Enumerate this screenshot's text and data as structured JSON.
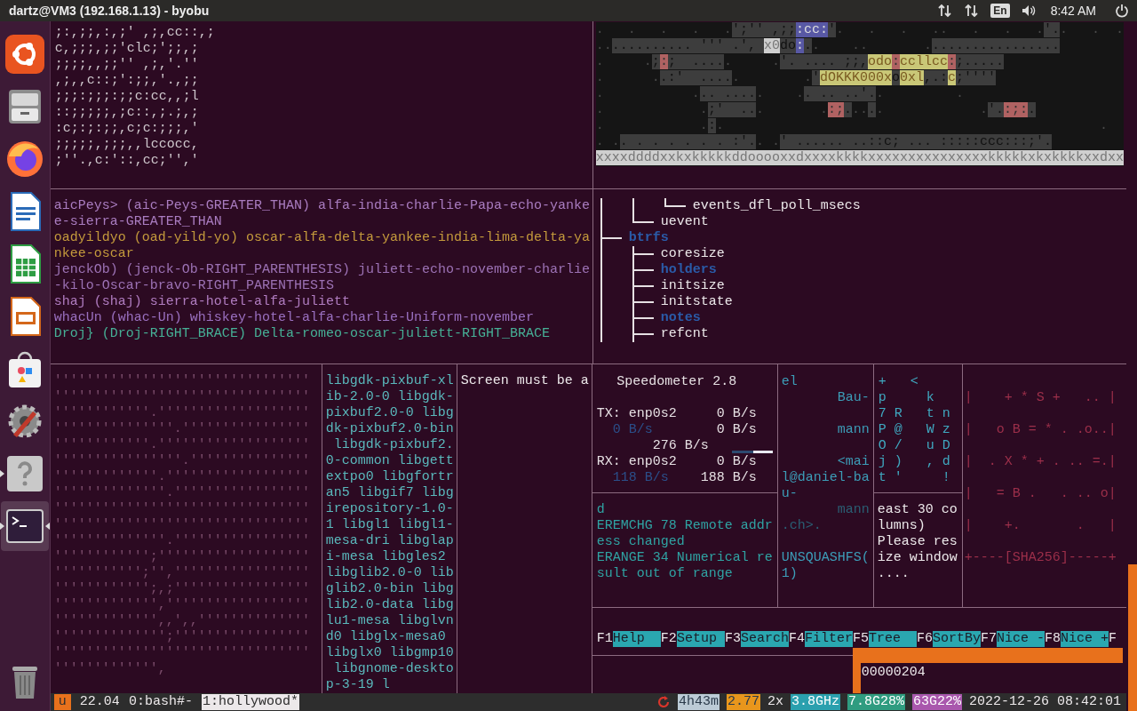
{
  "top_bar": {
    "title": "dartz@VM3 (192.168.1.13) - byobu",
    "language": "En",
    "clock": "8:42 AM"
  },
  "dock": {
    "items": [
      {
        "kind": "ubuntu",
        "running": false,
        "focused": false
      },
      {
        "kind": "files",
        "running": false,
        "focused": false
      },
      {
        "kind": "firefox",
        "running": false,
        "focused": false
      },
      {
        "kind": "writer",
        "running": false,
        "focused": false
      },
      {
        "kind": "calc",
        "running": false,
        "focused": false
      },
      {
        "kind": "impress",
        "running": false,
        "focused": false
      },
      {
        "kind": "software",
        "running": false,
        "focused": false
      },
      {
        "kind": "settings",
        "running": false,
        "focused": false
      },
      {
        "kind": "help",
        "running": true,
        "focused": false
      },
      {
        "kind": "terminal",
        "running": true,
        "focused": true
      },
      {
        "kind": "trash",
        "running": false,
        "focused": false
      }
    ]
  },
  "ascii_art": {
    "lines": [
      ";:,;;,:,;' ,;,cc::,;",
      "c,;;;,;;'clc;';;,;",
      ";;;;,,;;'' ,;,'.''",
      ",;,,c::;':;;,'.,;;",
      ";;;:;;;:;;c:cc,,;l",
      "::;;;;;,;c::,;.;,;",
      ":c;:;:;;,c;c:;;;,'",
      ";;;;;,;;;,,lccocc,",
      ";''.,c:'::,cc;'','"
    ]
  },
  "ascii_image": {
    "rows": [
      {
        "segments": [
          {
            "text": ".   .   .   .   .",
            "kind": "dark"
          },
          {
            "text": "';'' ,;;",
            "kind": "gray"
          },
          {
            "text": ":cc:",
            "kind": "blue"
          },
          {
            "text": "'",
            "kind": "gray"
          },
          {
            "text": ".   .   .   ..   .   .   .",
            "kind": "dark"
          },
          {
            "text": "'.",
            "kind": "gray"
          },
          {
            "text": ".   .  .",
            "kind": "dark"
          }
        ]
      },
      {
        "segments": [
          {
            "text": "..",
            "kind": "dark"
          },
          {
            "text": ".......... ''' .', ",
            "kind": "gray"
          },
          {
            "text": "x0",
            "kind": "light"
          },
          {
            "text": "do",
            "kind": "gray"
          },
          {
            "text": ":",
            "kind": "blue"
          },
          {
            "text": ".",
            "kind": "gray"
          },
          {
            "text": ".    ..       .",
            "kind": "dark"
          },
          {
            "text": "................",
            "kind": "gray"
          }
        ]
      },
      {
        "segments": [
          {
            "text": ".     .",
            "kind": "dark"
          },
          {
            "text": ";",
            "kind": "gray"
          },
          {
            "text": ":",
            "kind": "red"
          },
          {
            "text": ";  ....",
            "kind": "gray"
          },
          {
            "text": ".     .",
            "kind": "dark"
          },
          {
            "text": "'. .... ;;,",
            "kind": "gray"
          },
          {
            "text": "odo",
            "kind": "yellow"
          },
          {
            "text": ":",
            "kind": "red"
          },
          {
            "text": "ccllcc",
            "kind": "yellow"
          },
          {
            "text": ":",
            "kind": "red"
          },
          {
            "text": ";.....",
            "kind": "gray"
          }
        ]
      },
      {
        "segments": [
          {
            "text": ".      .",
            "kind": "dark"
          },
          {
            "text": ".:'  ....",
            "kind": "gray"
          },
          {
            "text": ".        .",
            "kind": "dark"
          },
          {
            "text": "'",
            "kind": "gray"
          },
          {
            "text": "dOKKK000x",
            "kind": "yellow"
          },
          {
            "text": "o",
            "kind": "gray"
          },
          {
            "text": "0xl",
            "kind": "yellow"
          },
          {
            "text": ",.:",
            "kind": "gray"
          },
          {
            "text": "c",
            "kind": "yellow"
          },
          {
            "text": ";''''",
            "kind": "gray"
          }
        ]
      },
      {
        "segments": [
          {
            "text": ".           .",
            "kind": "dark"
          },
          {
            "text": ".. ....",
            "kind": "gray"
          },
          {
            "text": ".    .",
            "kind": "dark"
          },
          {
            "text": ". .. ..'.",
            "kind": "gray"
          },
          {
            "text": ".         .",
            "kind": "dark"
          }
        ]
      },
      {
        "segments": [
          {
            "text": ".            .",
            "kind": "dark"
          },
          {
            "text": ";'  ..",
            "kind": "gray"
          },
          {
            "text": ".       .",
            "kind": "dark"
          },
          {
            "text": ":;",
            "kind": "red"
          },
          {
            "text": ".",
            "kind": "gray"
          },
          {
            "text": "..",
            "kind": "dark"
          },
          {
            "text": ".",
            "kind": "gray"
          },
          {
            "text": ".            .",
            "kind": "dark"
          },
          {
            "text": "'.",
            "kind": "gray"
          },
          {
            "text": ":;:",
            "kind": "red"
          },
          {
            "text": ".",
            "kind": "gray"
          }
        ]
      },
      {
        "segments": [
          {
            "text": ".            .",
            "kind": "dark"
          },
          {
            "text": ":",
            "kind": "gray"
          },
          {
            "text": ".                                               .",
            "kind": "dark"
          }
        ]
      },
      {
        "segments": [
          {
            "text": ". .",
            "kind": "dark"
          },
          {
            "text": ". . . . . . . :'.",
            "kind": "gray"
          },
          {
            "text": ". .",
            "kind": "dark"
          },
          {
            "text": "' ...... ..::c; ... :::::ccc:::;'.",
            "kind": "gray"
          }
        ]
      },
      {
        "segments": [
          {
            "text": "xxxxddddxxkxkkkkkddooooxxdxxxxkkkkxxxxxxxxxxxxxxxkkkkkxkxkkkkxxdxx",
            "kind": "light"
          }
        ]
      }
    ]
  },
  "word_list": {
    "entries": [
      {
        "color": "#a97cc0",
        "lines": [
          "aicPeys> (aic-Peys-GREATER_THAN) alfa-india-charlie-Papa-echo-yanke",
          "e-sierra-GREATER_THAN"
        ]
      },
      {
        "color": "#c49a3c",
        "lines": [
          "oadyildyo (oad-yild-yo) oscar-alfa-delta-yankee-india-lima-delta-ya",
          "nkee-oscar"
        ]
      },
      {
        "color": "#9c72b5",
        "lines": [
          "jenckOb) (jenck-Ob-RIGHT_PARENTHESIS) juliett-echo-november-charlie",
          "-kilo-Oscar-bravo-RIGHT_PARENTHESIS"
        ]
      },
      {
        "color": "#b07cc0",
        "lines": [
          "shaj (shaj) sierra-hotel-alfa-juliett"
        ]
      },
      {
        "color": "#9a70c0",
        "lines": [
          "whacUn (whac-Un) whiskey-hotel-alfa-charlie-Uniform-november"
        ]
      },
      {
        "color": "#46b096",
        "lines": [
          "Droj} (Droj-RIGHT_BRACE) Delta-romeo-oscar-juliett-RIGHT_BRACE"
        ]
      }
    ]
  },
  "tree": {
    "items": [
      {
        "last": false,
        "children": [
          {
            "last": false,
            "children": [
              {
                "name": "events_dfl_poll_msecs",
                "dir": false,
                "last": true
              }
            ]
          },
          {
            "name": "uevent",
            "dir": false,
            "last": true
          }
        ]
      },
      {
        "name": "btrfs",
        "dir": true,
        "last": false,
        "children": [
          {
            "name": "coresize",
            "dir": false,
            "last": false
          },
          {
            "name": "holders",
            "dir": true,
            "last": false
          },
          {
            "name": "initsize",
            "dir": false,
            "last": false
          },
          {
            "name": "initstate",
            "dir": false,
            "last": false
          },
          {
            "name": "notes",
            "dir": true,
            "last": false
          },
          {
            "name": "refcnt",
            "dir": false,
            "last": false
          }
        ]
      }
    ]
  },
  "dot_field": {
    "lines": [
      "''''''''''''''''''''''''''''''''",
      "''''''''''''''''''''''''''''''''",
      "''''''''''''.'''''''''''''''''''",
      "'''''''''''''''.''''''''''''''''",
      "''''''''''''.'''''''''''''''''''",
      "''''''''''''''''.'''''''''''''''",
      "'''''''''''''.''''''''''''''''''",
      "''''''''''''''.'''''''''''''''''",
      "''''''''''''''''''''''''''''''''",
      "''''''''''''''''''''''''''''''''",
      "''''''''''''''.'''''''''''''''''",
      "'''''''''''';'''''''''''''''''''",
      "''''''''''';'','''''''''''''''''",
      "'''''''''''';,;'''''''''''''''''",
      "''''''''''''',''''''''''''''''''",
      "''''''''''''',,',,''''''''''''''",
      "'''''''''''''';'''''''''''''''''",
      "''''''''''''''''''''''''''''''''",
      "''''''''''''',"
    ]
  },
  "package_list": {
    "lines": [
      "libgdk-pixbuf-xl",
      "ib-2.0-0 libgdk-",
      "pixbuf2.0-0 libg",
      "dk-pixbuf2.0-bin",
      " libgdk-pixbuf2.",
      "0-common libgett",
      "extpo0 libgfortr",
      "an5 libgif7 libg",
      "irepository-1.0-",
      "1 libgl1 libgl1-",
      "mesa-dri libglap",
      "i-mesa libgles2",
      "libglib2.0-0 lib",
      "glib2.0-bin libg",
      "lib2.0-data libg",
      "lu1-mesa libglvn",
      "d0 libglx-mesa0",
      "libglx0 libgmp10",
      " libgnome-deskto",
      "p-3-19 l"
    ]
  },
  "message": {
    "lines": [
      "Screen must be a"
    ]
  },
  "speedometer": {
    "title": "Speedometer 2.8",
    "rows": [
      {
        "kind": "iface",
        "label": "TX: enp0s2",
        "rate": "0 B/s"
      },
      {
        "kind": "rates",
        "dim": "0 B/s",
        "rate": "0 B/s"
      },
      {
        "kind": "peak",
        "rate": "276 B/s"
      },
      {
        "kind": "iface",
        "label": "RX: enp0s2",
        "rate": "0 B/s"
      },
      {
        "kind": "rates",
        "dim": "118 B/s",
        "rate": "188 B/s"
      }
    ]
  },
  "errors": {
    "lines": [
      "d",
      "EREMCHG 78 Remote addr",
      "ess changed",
      "ERANGE 34 Numerical re",
      "sult out of range"
    ]
  },
  "manpage": {
    "lines": [
      {
        "kind": "text",
        "text": "el",
        "right_aligned": false,
        "dim": false
      },
      {
        "kind": "text",
        "text": "Bau-",
        "right_aligned": true,
        "dim": false
      },
      {
        "kind": "blank"
      },
      {
        "kind": "text",
        "text": "mann",
        "right_aligned": true,
        "dim": false
      },
      {
        "kind": "blank"
      },
      {
        "kind": "text",
        "text": "<mai",
        "right_aligned": true,
        "dim": false
      },
      {
        "kind": "text",
        "text": "l@daniel-ba",
        "dim": false
      },
      {
        "kind": "text",
        "text": "u-",
        "right_aligned": false,
        "dim": false
      },
      {
        "kind": "text",
        "text": "mann",
        "right_aligned": true,
        "dim": true
      },
      {
        "kind": "text",
        "text": ".ch>.",
        "right_aligned": false,
        "dim": true
      },
      {
        "kind": "blank"
      },
      {
        "kind": "text",
        "text": "UNSQUASHFS(",
        "dim": false
      },
      {
        "kind": "text",
        "text": "1)",
        "right_aligned": false,
        "dim": false
      }
    ]
  },
  "chars": {
    "upper": [
      "+   <",
      "p     k",
      "7 R   t n",
      "P @   W z",
      "O /   u D",
      "j )   , d",
      "t '     !"
    ],
    "lower": [
      "east 30 co",
      "lumns)",
      "Please res",
      "ize window",
      "...."
    ]
  },
  "sha_art": {
    "lines": [
      "|    + * S +   .. |",
      "|   o B = * . .o..|",
      "|  . X * + . .. =.|",
      "|   = B .   . .. o|",
      "|    +.       .   |",
      "+----[SHA256]-----+"
    ]
  },
  "htop_keys": [
    {
      "key": "F1",
      "label": "Help"
    },
    {
      "key": "F2",
      "label": "Setup"
    },
    {
      "key": "F3",
      "label": "Search"
    },
    {
      "key": "F4",
      "label": "Filter"
    },
    {
      "key": "F5",
      "label": "Tree"
    },
    {
      "key": "F6",
      "label": "SortBy"
    },
    {
      "key": "F7",
      "label": "Nice -"
    },
    {
      "key": "F8",
      "label": "Nice +"
    }
  ],
  "htop_tail": "F",
  "hexdump": {
    "lines": [
      "00000204"
    ]
  },
  "status_bar": {
    "left": [
      {
        "kind": "logo",
        "text": "u"
      },
      {
        "kind": "plain",
        "text": "22.04"
      },
      {
        "kind": "window",
        "text": "0:bash#-",
        "selected": false
      },
      {
        "kind": "window",
        "text": "1:hollywood*",
        "selected": true
      }
    ],
    "right": [
      {
        "kind": "badge",
        "text": "4h43m",
        "color": "#bccbd6"
      },
      {
        "kind": "badge",
        "text": "2.77",
        "color": "#e8961c"
      },
      {
        "kind": "plain",
        "text": "2x"
      },
      {
        "kind": "badge",
        "text": "3.8GHz",
        "color": "#2aa0ae"
      },
      {
        "kind": "badge",
        "text": "7.8G28%",
        "color": "#2f9c80"
      },
      {
        "kind": "badge",
        "text": "63G22%",
        "color": "#a957ad"
      },
      {
        "kind": "plain",
        "text": "2022-12-26 08:42:01"
      }
    ]
  }
}
